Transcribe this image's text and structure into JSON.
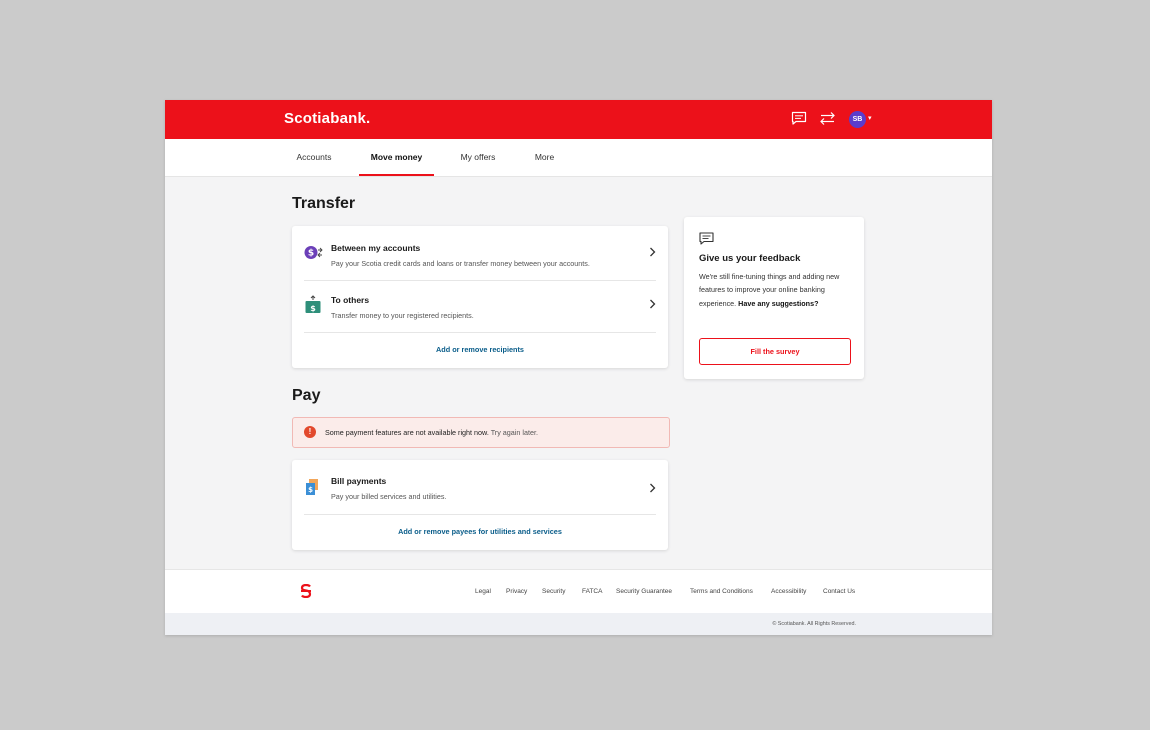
{
  "header": {
    "brand": "Scotiabank.",
    "icons": [
      "chat-icon",
      "transfer-arrows-icon"
    ],
    "avatar_initials": "SB",
    "colors": {
      "brand_red": "#ec111a",
      "avatar": "#5b3ccc",
      "link_blue": "#0a5d8a"
    }
  },
  "nav": {
    "items": [
      {
        "label": "Accounts"
      },
      {
        "label": "Move money",
        "active": true
      },
      {
        "label": "My offers"
      },
      {
        "label": "More"
      }
    ]
  },
  "transfer": {
    "title": "Transfer",
    "items": [
      {
        "title": "Between my accounts",
        "description": "Pay your Scotia credit cards and loans or transfer money between your accounts.",
        "icon": "between-accounts-icon"
      },
      {
        "title": "To others",
        "description": "Transfer money to your registered recipients.",
        "icon": "money-transfer-icon"
      }
    ],
    "link": "Add or remove recipients"
  },
  "pay": {
    "title": "Pay",
    "alert": {
      "text": "Some payment features are not available right now.",
      "subtext": "Try again later."
    },
    "items": [
      {
        "title": "Bill payments",
        "description": "Pay your billed services and utilities.",
        "icon": "bill-icon"
      }
    ],
    "link": "Add or remove payees for utilities and services"
  },
  "feedback": {
    "title": "Give us your feedback",
    "body": "We're still fine-tuning things and adding new features to improve your online banking experience.",
    "body_bold": "Have any suggestions?",
    "button": "Fill the survey"
  },
  "footer": {
    "links": [
      "Legal",
      "Privacy",
      "Security",
      "FATCA",
      "Security Guarantee",
      "Terms and Conditions",
      "Accessibility",
      "Contact Us"
    ],
    "copyright": "© Scotiabank. All Rights Reserved."
  }
}
